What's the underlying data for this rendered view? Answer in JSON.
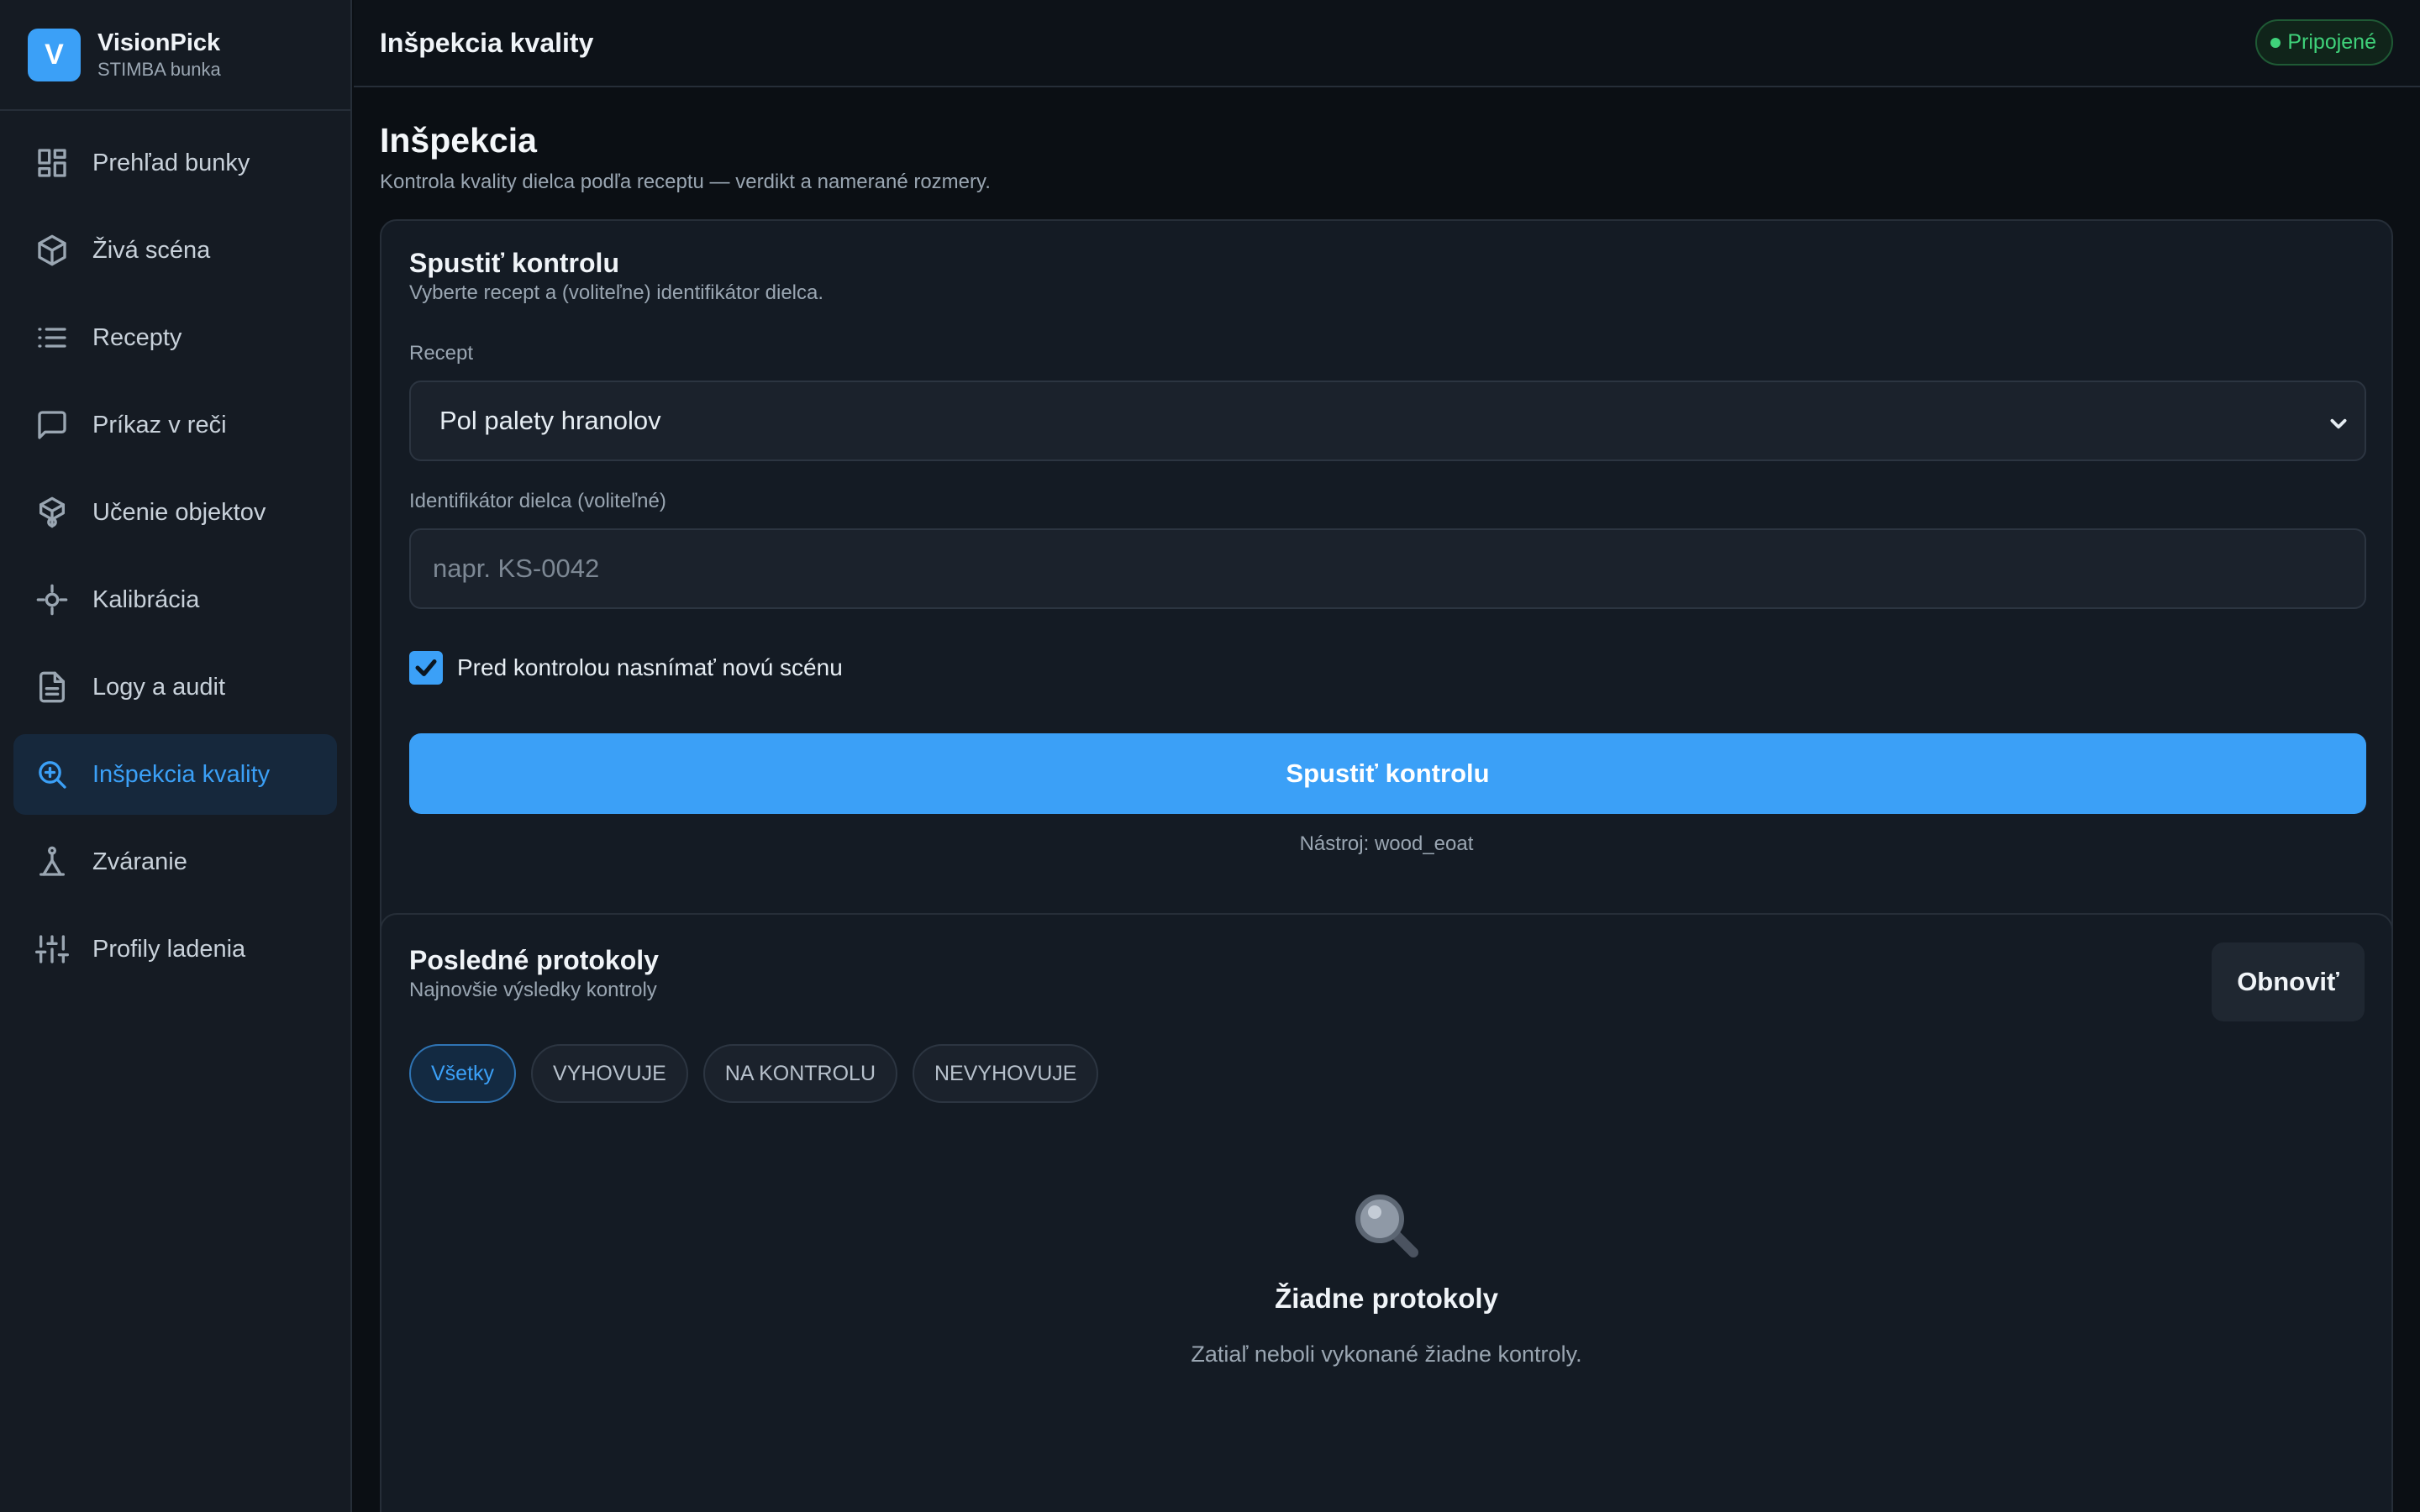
{
  "brand": {
    "initial": "V",
    "name": "VisionPick",
    "subtitle": "STIMBA bunka"
  },
  "sidebar": {
    "items": [
      {
        "label": "Prehľad bunky",
        "icon": "dashboard-icon"
      },
      {
        "label": "Živá scéna",
        "icon": "cube-icon"
      },
      {
        "label": "Recepty",
        "icon": "list-icon"
      },
      {
        "label": "Príkaz v reči",
        "icon": "message-icon"
      },
      {
        "label": "Učenie objektov",
        "icon": "box-learn-icon"
      },
      {
        "label": "Kalibrácia",
        "icon": "crosshair-icon"
      },
      {
        "label": "Logy a audit",
        "icon": "file-text-icon"
      },
      {
        "label": "Inšpekcia kvality",
        "icon": "zoom-icon",
        "active": true
      },
      {
        "label": "Zváranie",
        "icon": "welding-icon"
      },
      {
        "label": "Profily ladenia",
        "icon": "sliders-icon"
      }
    ]
  },
  "header": {
    "title": "Inšpekcia kvality",
    "status": "Pripojené",
    "status_color": "#3fd27a"
  },
  "page": {
    "title": "Inšpekcia",
    "subtitle": "Kontrola kvality dielca podľa receptu — verdikt a namerané rozmery."
  },
  "run_card": {
    "title": "Spustiť kontrolu",
    "subtitle": "Vyberte recept a (voliteľne) identifikátor dielca.",
    "recipe_label": "Recept",
    "recipe_value": "Pol palety hranolov",
    "part_id_label": "Identifikátor dielca (voliteľné)",
    "part_id_placeholder": "napr. KS-0042",
    "part_id_value": "",
    "capture_label": "Pred kontrolou nasnímať novú scénu",
    "capture_checked": true,
    "run_button": "Spustiť kontrolu",
    "tool_note": "Nástroj: wood_eoat"
  },
  "protocols_card": {
    "title": "Posledné protokoly",
    "subtitle": "Najnovšie výsledky kontroly",
    "refresh_button": "Obnoviť",
    "filters": [
      "Všetky",
      "VYHOVUJE",
      "NA KONTROLU",
      "NEVYHOVUJE"
    ],
    "active_filter": "Všetky",
    "empty_title": "Žiadne protokoly",
    "empty_subtitle": "Zatiaľ neboli vykonané žiadne kontroly."
  },
  "colors": {
    "accent": "#3ba0f7",
    "background": "#0b0f14",
    "card": "#141b24",
    "success": "#3fd27a"
  }
}
